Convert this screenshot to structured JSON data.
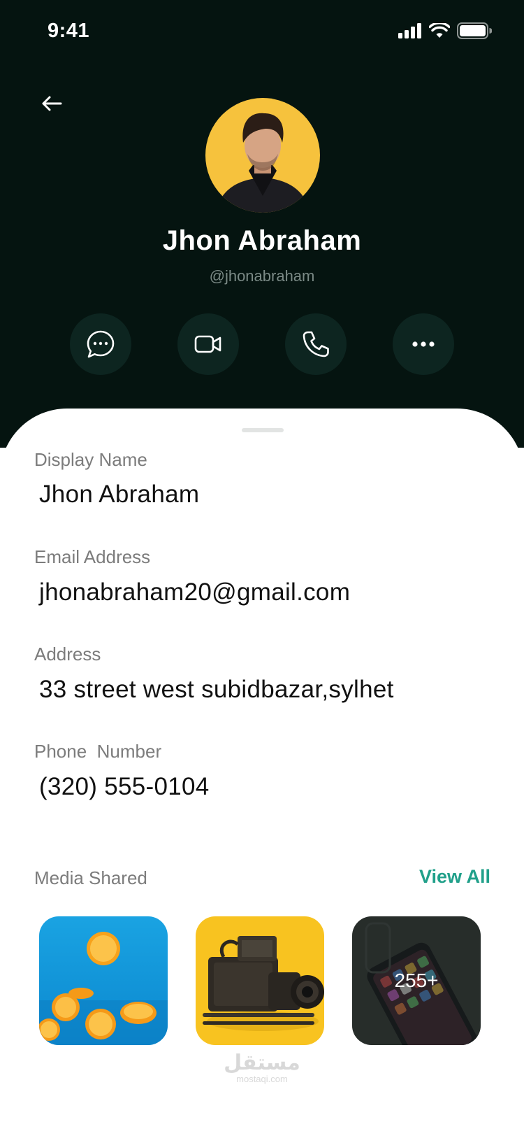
{
  "status_bar": {
    "time": "9:41"
  },
  "profile": {
    "name": "Jhon Abraham",
    "handle": "@jhonabraham"
  },
  "actions": [
    {
      "icon": "message-icon"
    },
    {
      "icon": "video-icon"
    },
    {
      "icon": "phone-icon"
    },
    {
      "icon": "more-icon"
    }
  ],
  "details": {
    "display_name_label": "Display Name",
    "display_name": "Jhon Abraham",
    "email_label": "Email Address",
    "email": "jhonabraham20@gmail.com",
    "address_label": "Address",
    "address": "33 street west subidbazar,sylhet",
    "phone_label": "Phone  Number",
    "phone": "(320) 555-0104"
  },
  "media": {
    "label": "Media Shared",
    "view_all": "View All",
    "more_count": "255+"
  },
  "watermark": {
    "arabic": "مستقل",
    "latin": "mostaqi.com"
  },
  "colors": {
    "header_bg": "#051410",
    "action_bg": "#0d2520",
    "accent": "#21a08a",
    "avatar_bg": "#f6c23d"
  }
}
